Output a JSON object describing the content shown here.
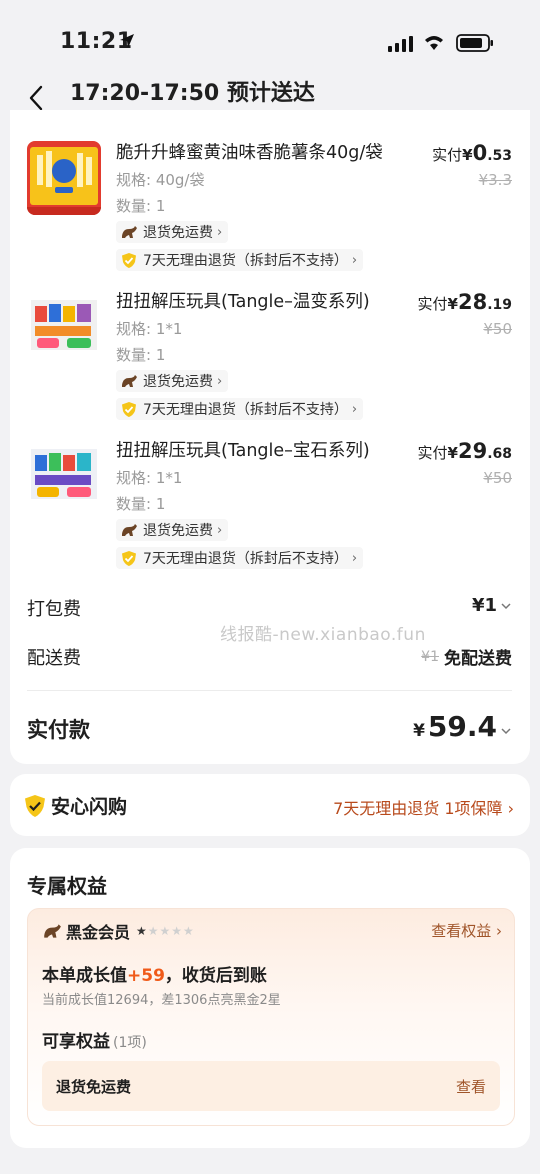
{
  "status_bar": {
    "time": "11:21"
  },
  "header": {
    "title": "17:20-17:50 预计送达"
  },
  "products": [
    {
      "name": "脆升升蜂蜜黄油味香脆薯条40g/袋",
      "spec": "规格: 40g/袋",
      "qty": "数量: 1",
      "price_label": "实付",
      "price_yen": "¥",
      "price_int": "0",
      "price_dec": ".53",
      "orig_price": "¥3.3",
      "tag_return": "退货免运费",
      "tag_7day": "7天无理由退货（拆封后不支持）"
    },
    {
      "name": "扭扭解压玩具(Tangle–温变系列)",
      "spec": "规格: 1*1",
      "qty": "数量: 1",
      "price_label": "实付",
      "price_yen": "¥",
      "price_int": "28",
      "price_dec": ".19",
      "orig_price": "¥50",
      "tag_return": "退货免运费",
      "tag_7day": "7天无理由退货（拆封后不支持）"
    },
    {
      "name": "扭扭解压玩具(Tangle–宝石系列)",
      "spec": "规格: 1*1",
      "qty": "数量: 1",
      "price_label": "实付",
      "price_yen": "¥",
      "price_int": "29",
      "price_dec": ".68",
      "orig_price": "¥50",
      "tag_return": "退货免运费",
      "tag_7day": "7天无理由退货（拆封后不支持）"
    }
  ],
  "fees": {
    "packing_label": "打包费",
    "packing_value": "¥1",
    "delivery_label": "配送费",
    "delivery_orig": "¥1",
    "delivery_value": "免配送费"
  },
  "watermark": "线报酷-new.xianbao.fun",
  "total": {
    "label": "实付款",
    "yen": "¥",
    "value": "59.4"
  },
  "safe": {
    "title": "安心闪购",
    "right": "7天无理由退货 1项保障 ›"
  },
  "rights": {
    "title": "专属权益",
    "member": "黑金会员",
    "stars": "★★★★★",
    "view": "查看权益 ›",
    "growth_prefix": "本单成长值",
    "growth_value": "+59",
    "growth_suffix": "，收货后到账",
    "growth_sub": "当前成长值12694，差1306点亮黑金2星",
    "enjoy": "可享权益",
    "enjoy_count": "(1项)",
    "benefit_name": "退货免运费",
    "benefit_view": "查看"
  },
  "colors": {
    "accent_orange": "#f05a19",
    "brown_link": "#a0552a",
    "safe_text": "#b84a1c"
  }
}
